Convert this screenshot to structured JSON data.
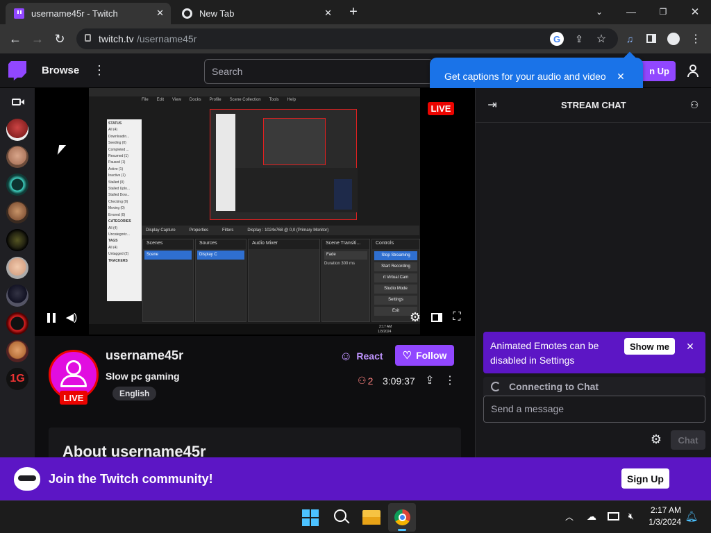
{
  "browser": {
    "tabs": [
      {
        "title": "username45r - Twitch",
        "icon": "twitch-favicon"
      },
      {
        "title": "New Tab",
        "icon": "chrome-favicon"
      }
    ],
    "url_domain": "twitch.tv",
    "url_path": "/username45r",
    "new_tab_symbol": "+",
    "window_controls": [
      "minimize",
      "restore",
      "close"
    ]
  },
  "twitch": {
    "browse_label": "Browse",
    "search_placeholder": "Search",
    "signup_label": "Sign Up",
    "signup_partial": "n Up",
    "captions_popup": "Get captions for your audio and video",
    "live_badge": "LIVE",
    "stream_chat_title": "STREAM CHAT",
    "channel": {
      "name": "username45r",
      "title": "Slow pc gaming",
      "tag": "English",
      "live_badge": "LIVE",
      "viewers": "2",
      "uptime": "3:09:37",
      "react_label": "React",
      "follow_label": "Follow",
      "about_heading": "About username45r"
    },
    "chat": {
      "notice_text": "Animated Emotes can be disabled in Settings",
      "show_me_label": "Show me",
      "connecting_text": "Connecting to Chat",
      "message_placeholder": "Send a message",
      "chat_button_label": "Chat"
    },
    "join_banner": {
      "text": "Join the Twitch community!",
      "signup_label": "Sign Up"
    },
    "sidenav_channels": [
      "channel-1",
      "channel-2",
      "channel-3",
      "channel-4",
      "channel-5",
      "channel-6",
      "channel-7",
      "channel-8",
      "channel-9",
      "channel-10"
    ],
    "accent_color": "#9147ff",
    "live_color": "#eb0400"
  },
  "obs": {
    "panels": [
      "Scenes",
      "Sources",
      "Audio Mixer",
      "Scene Transiti...",
      "Controls"
    ],
    "scene_item": "Scene",
    "source_item": "Display C",
    "transition_value": "Fade",
    "duration_label": "Duration",
    "duration_value": "300 ms",
    "controls": [
      "Stop Streaming",
      "Start Recording",
      "rt Virtual Cam",
      "Studio Mode",
      "Settings",
      "Exit"
    ],
    "source_toolbar": [
      "Display Capture",
      "Properties",
      "Filters",
      "Display",
      ": 1024x768 @ 0,0 (Primary Monitor)"
    ],
    "status_items": [
      "STATUS",
      "All (4)",
      "Downloadin...",
      "Seeding (0)",
      "Completed ...",
      "Resumed (1)",
      "Paused (1)",
      "Active (1)",
      "Inactive (1)",
      "Stalled (0)",
      "Stalled Uplo...",
      "Stalled Dow...",
      "Checking (0)",
      "Moving (0)",
      "Errored (0)",
      "CATEGORIES",
      "All (4)",
      "Uncategoriz...",
      "TAGS",
      "All (4)",
      "Untagged (2)",
      "TRACKERS"
    ],
    "menu": [
      "File",
      "Edit",
      "View",
      "Docks",
      "Profile",
      "Scene Collection",
      "Tools",
      "Help"
    ],
    "time": "2:17 AM",
    "date": "1/3/2024"
  },
  "taskbar": {
    "time": "2:17 AM",
    "date": "1/3/2024"
  }
}
